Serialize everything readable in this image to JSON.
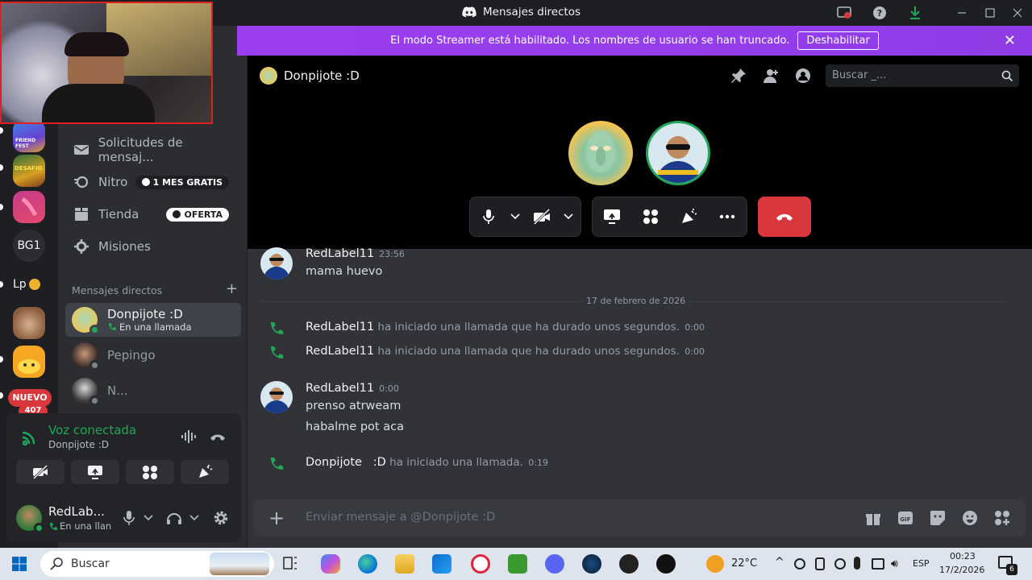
{
  "window": {
    "title": "Mensajes directos"
  },
  "streamer_banner": {
    "text": "El modo Streamer está habilitado. Los nombres de usuario se han truncado.",
    "button": "Deshabilitar"
  },
  "guilds": {
    "bg_label": "BG1",
    "lp_label": "Lp",
    "new_badge": "NUEVO",
    "new_count": "407"
  },
  "sidebar": {
    "nav": [
      {
        "label": "Solicitudes de mensaj..."
      },
      {
        "label": "Nitro",
        "pill": "1 MES GRATIS"
      },
      {
        "label": "Tienda",
        "pill": "OFERTA"
      },
      {
        "label": "Misiones"
      }
    ],
    "dm_header": "Mensajes directos",
    "dms": [
      {
        "name": "Donpijote :D",
        "status": "En una llamada"
      },
      {
        "name": "Pepingo"
      },
      {
        "name": "N..."
      }
    ]
  },
  "voice": {
    "status": "Voz conectada",
    "channel": "Donpijote :D"
  },
  "user": {
    "name": "RedLab...",
    "status": "En una llan"
  },
  "call": {
    "title": "Donpijote :D",
    "search_placeholder": "Buscar _..."
  },
  "messages": {
    "first": {
      "author": "RedLabel11",
      "time": "23:56",
      "text": "mama huevo"
    },
    "date_divider": "17 de febrero de 2026",
    "system": [
      {
        "author": "RedLabel11",
        "text": "ha iniciado una llamada que ha durado unos segundos.",
        "time": "0:00"
      },
      {
        "author": "RedLabel11",
        "text": "ha iniciado una llamada que ha durado unos segundos.",
        "time": "0:00"
      }
    ],
    "second": {
      "author": "RedLabel11",
      "time": "0:00",
      "lines": [
        "prenso atrweam",
        "habalme  pot aca"
      ]
    },
    "last_system": {
      "author": "Donpijote   :D",
      "text": "ha iniciado una llamada.",
      "time": "0:19"
    }
  },
  "composer": {
    "placeholder": "Enviar mensaje a @Donpijote :D"
  },
  "taskbar": {
    "search": "Buscar",
    "temperature": "22°C",
    "lang": "ESP",
    "time": "00:23",
    "date": "17/2/2026",
    "notif_count": "6"
  },
  "colors": {
    "accent_purple": "#9b3ef0",
    "online_green": "#23a55a",
    "hangup_red": "#da373c"
  }
}
